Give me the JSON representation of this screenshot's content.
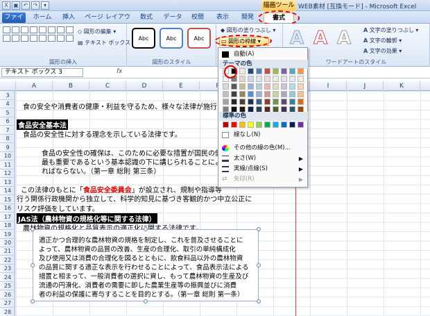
{
  "window": {
    "context_tab": "描画ツール",
    "title": "WEB素材 [互換モード] - Microsoft Excel"
  },
  "tabs": [
    "ファイル",
    "ホーム",
    "挿入",
    "ページ レイアウト",
    "数式",
    "データ",
    "校閲",
    "表示",
    "開発",
    "書式"
  ],
  "ribbon": {
    "edit_shape": "図形の編集",
    "textbox": "テキスト ボックス",
    "group_insert": "図形の挿入",
    "abc": "Abc",
    "shape_fill": "図形の塗りつぶし",
    "shape_outline": "図形の枠線",
    "group_style": "図形のスタイル",
    "text_fill": "文字の塗りつぶし",
    "text_outline": "文字の輪郭",
    "text_effect": "文字の効果",
    "group_wordart": "ワードアートのスタイル",
    "wordart_letter": "A"
  },
  "namebox": "テキスト ボックス 3",
  "fx": "fx",
  "columns": [
    "A",
    "B",
    "C",
    "D",
    "E",
    "F",
    "G",
    "H",
    "I",
    "J",
    "K"
  ],
  "rows": [
    "3",
    "4",
    "5",
    "6",
    "7",
    "8",
    "9",
    "10",
    "11",
    "12",
    "13",
    "14",
    "15",
    "16",
    "17",
    "18",
    "19",
    "20",
    "21",
    "22",
    "23",
    "24",
    "25",
    "26",
    "27",
    "28"
  ],
  "sheet": {
    "r5": "食の安全や消費者の健康・利益を守るため、様々な法律が施行さ",
    "r7": "食品安全基本法",
    "r8": "食品の安全性に対する理念を示している法律です。",
    "r10": "食品の安全性の確保は、このために必要な措置が国民の健",
    "r11": "最も重要であるという基本認識の下に講じられることにより、",
    "r12": "ればならない。（第一章 総則 第三条）",
    "r14a": "この法律のもとに「",
    "r14red": "食品安全委員会",
    "r14b": "」が設立され、規制や指導等",
    "r15": "行う関係行政機関から独立して、科学的知見に基づき客観的かつ中立公正に",
    "r16": "リスク評価をしています。",
    "r18": "JAS法（農林物資の規格化等に関する法律）",
    "r19": "農林物資の規格化と品質表示の適正化に関する法律です。"
  },
  "textbox_lines": [
    "適正かつ合理的な農林物資の規格を制定し、これを普及させることに",
    "よって、農林物資の品質の改善、生産の合理化、取引の単純構成化",
    "及び使用又は消費の合理化を図るとともに、飲食料品以外の農林物資",
    "の品質に関する適正な表示を行わせることによって、食品表示法による",
    "措置と相まって、一般消費者の選択に資し、もって農林物資の生産及び",
    "流通の円滑化、消費者の需要に即した農業生産等の振興並びに消費",
    "者の利益の保護に寄与することを目的とする。（第一章 総則 第一条）"
  ],
  "menu": {
    "auto": "自動(A)",
    "theme_colors": "テーマの色",
    "standard_colors": "標準の色",
    "no_line": "線なし(N)",
    "more_colors": "その他の線の色(M)...",
    "weight": "太さ(W)",
    "dashes": "実線/点線(S)",
    "arrows": "矢印(R)"
  },
  "theme_palette": [
    [
      "#ffffff",
      "#000000",
      "#eeece1",
      "#1f497d",
      "#4f81bd",
      "#c0504d",
      "#9bbb59",
      "#8064a2",
      "#4bacc6",
      "#f79646"
    ],
    [
      "#f2f2f2",
      "#7f7f7f",
      "#ddd9c3",
      "#c6d9f0",
      "#dbe5f1",
      "#f2dcdb",
      "#ebf1dd",
      "#e5e0ec",
      "#dbeef3",
      "#fdeada"
    ],
    [
      "#d8d8d8",
      "#595959",
      "#c4bd97",
      "#8db3e2",
      "#b8cce4",
      "#e5b9b7",
      "#d7e3bc",
      "#ccc1d9",
      "#b7dde8",
      "#fbd5b5"
    ],
    [
      "#bfbfbf",
      "#3f3f3f",
      "#938953",
      "#548dd4",
      "#95b3d7",
      "#d99694",
      "#c3d69b",
      "#b2a2c7",
      "#92cddc",
      "#fac08f"
    ],
    [
      "#a5a5a5",
      "#262626",
      "#494429",
      "#17365d",
      "#366092",
      "#953734",
      "#76923c",
      "#5f497a",
      "#31859b",
      "#e36c09"
    ],
    [
      "#7f7f7f",
      "#0c0c0c",
      "#1d1b10",
      "#0f243e",
      "#244061",
      "#632423",
      "#4f6128",
      "#3f3151",
      "#205867",
      "#974806"
    ]
  ],
  "standard_palette": [
    "#c00000",
    "#ff0000",
    "#ffc000",
    "#ffff00",
    "#92d050",
    "#00b050",
    "#00b0f0",
    "#0070c0",
    "#002060",
    "#7030a0"
  ]
}
